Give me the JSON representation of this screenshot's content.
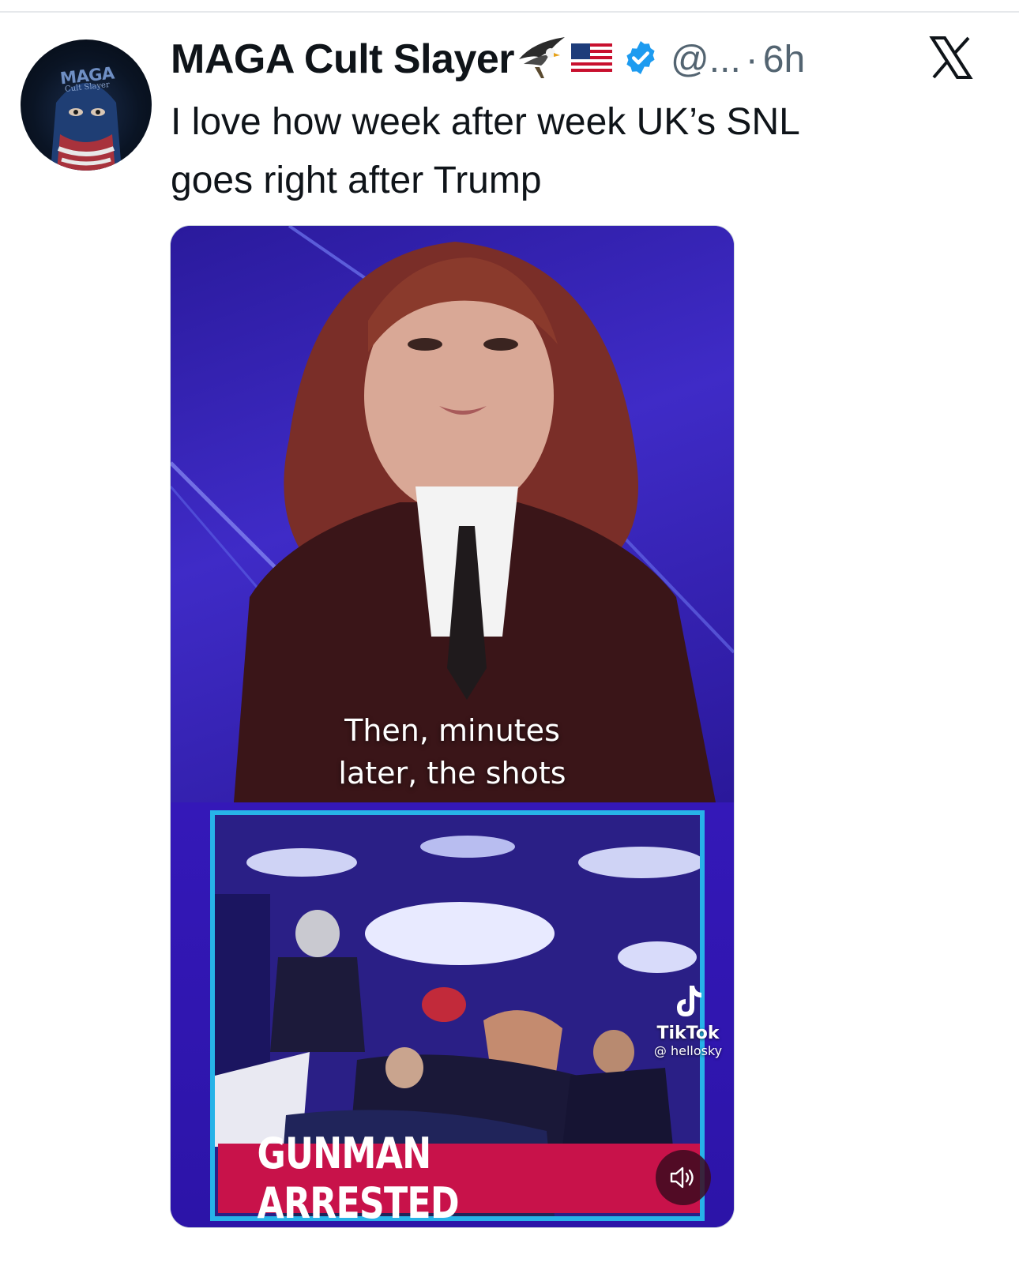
{
  "post": {
    "display_name": "MAGA Cult Slayer",
    "handle": "@...",
    "separator": "·",
    "timestamp": "6h",
    "text_lines": [
      "I love how week after week UK’s SNL",
      "goes right after Trump"
    ]
  },
  "avatar": {
    "title": "MAGA",
    "subtitle": "Cult Slayer"
  },
  "media": {
    "caption_lines": [
      "Then, minutes",
      "later, the shots"
    ],
    "banner": "GUNMAN ARRESTED",
    "watermark": {
      "brand": "TikTok",
      "user": "@ hellosky"
    }
  },
  "icons": [
    "eagle-icon",
    "us-flag-icon",
    "verified-icon",
    "x-logo-icon",
    "tiktok-icon",
    "speaker-icon"
  ],
  "colors": {
    "verified": "#1d9bf0",
    "text": "#0f1419",
    "muted": "#536471",
    "banner": "#c8124a",
    "inset_border": "#27b3e8"
  }
}
